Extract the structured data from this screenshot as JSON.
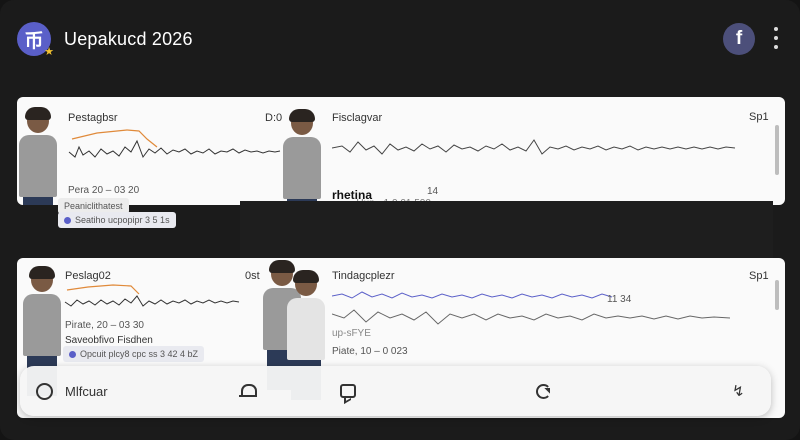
{
  "header": {
    "logo_glyph": "币",
    "title": "Uepakucd 2026",
    "facebook_glyph": "f"
  },
  "panel_top": {
    "left_card": {
      "title": "Pestagbsr",
      "badge": "D:0",
      "meta": "Pera 20 – 03 20",
      "sub_title": "Peaniclithatest",
      "row_text": "Seatiho ucpopipr 3 5 1s"
    },
    "right_card": {
      "title": "Fisclagvar",
      "corner": "Sp1",
      "label": "rhetina",
      "num_small": "14",
      "row_text": "· · ·   · Hun   · 1 0   01 500"
    }
  },
  "panel_bottom": {
    "left_card": {
      "title": "Peslag02",
      "badge": "0st",
      "meta": "Pirate, 20 – 03 30",
      "sub_title": "Saveobfivo Fisdhen",
      "row_text": "Opcuit plcy8 cpc ss 3 42 4 bZ"
    },
    "right_card": {
      "title": "Tindagcplezr",
      "corner": "Sp1",
      "value_a": "11 34",
      "label_b": "up-sFYE",
      "meta": "Piate, 10 – 0 023"
    }
  },
  "bottom_nav": {
    "home_label": "Mlfcuar"
  },
  "colors": {
    "background": "#1b1b1b",
    "accent": "#5a5fc8",
    "panel": "#fafafa",
    "spark_highlight": "#e08a3a"
  }
}
